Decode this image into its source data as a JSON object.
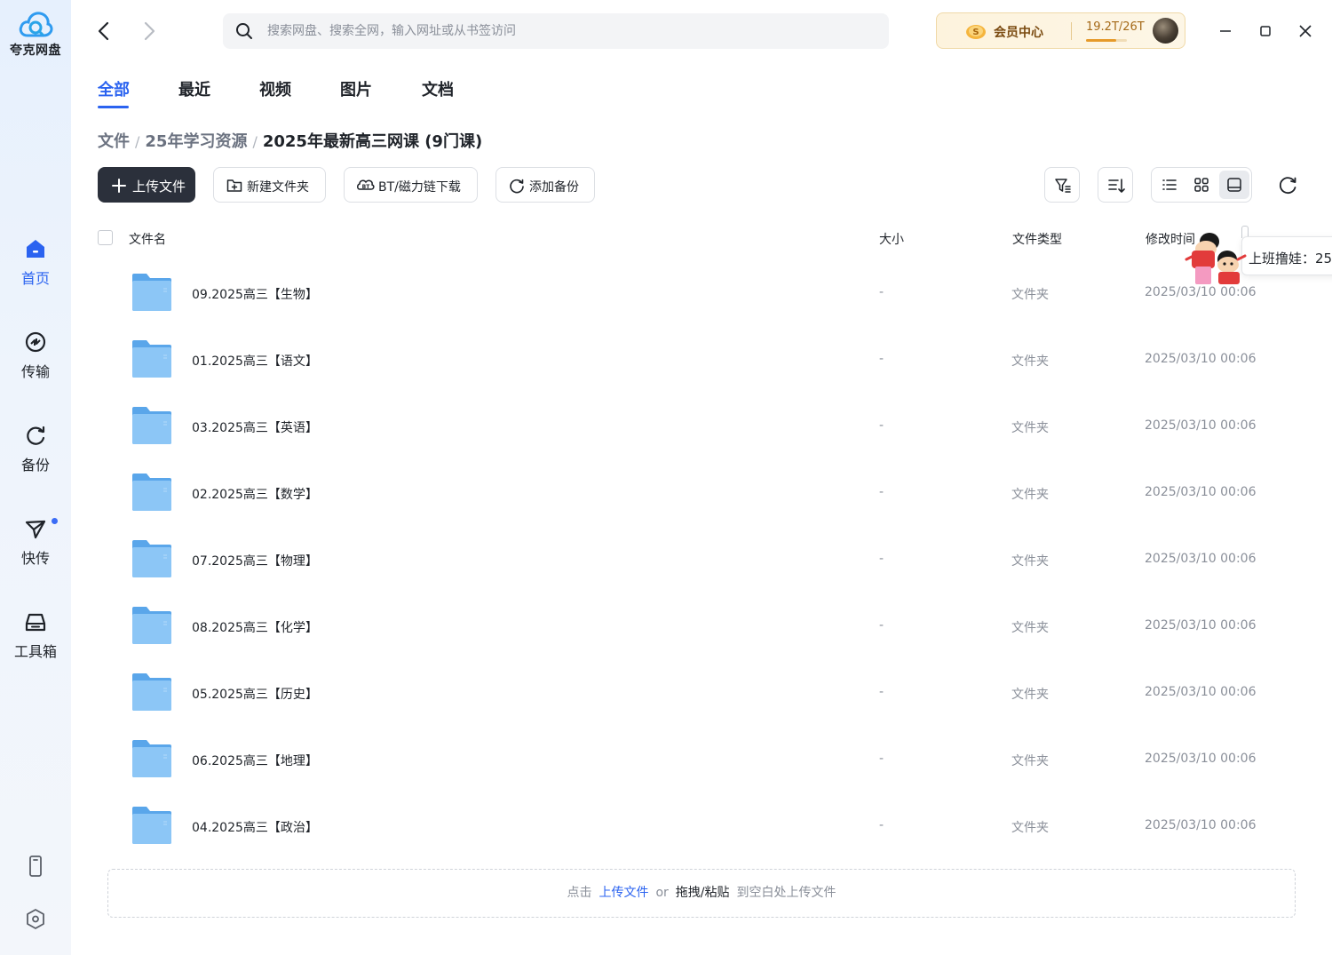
{
  "app": {
    "name": "夸克网盘"
  },
  "colors": {
    "accent": "#2b63f0",
    "primary_button": "#2b303b",
    "folder": "#6db0ee"
  },
  "sidebar": {
    "items": [
      {
        "label": "首页",
        "icon": "home-icon",
        "active": true
      },
      {
        "label": "传输",
        "icon": "transfer-icon"
      },
      {
        "label": "备份",
        "icon": "backup-icon"
      },
      {
        "label": "快传",
        "icon": "send-icon",
        "badge_dot": true
      },
      {
        "label": "工具箱",
        "icon": "toolbox-icon"
      }
    ],
    "bottom": [
      "phone-icon",
      "settings-hex-icon"
    ]
  },
  "search": {
    "placeholder": "搜索网盘、搜索全网，输入网址或从书签访问"
  },
  "member": {
    "label": "会员中心",
    "storage": "19.2T/26T",
    "storage_used_fraction": 0.738
  },
  "tabs": [
    {
      "label": "全部",
      "active": true
    },
    {
      "label": "最近"
    },
    {
      "label": "视频"
    },
    {
      "label": "图片"
    },
    {
      "label": "文档"
    }
  ],
  "breadcrumb": [
    "文件",
    "25年学习资源",
    "2025年最新高三网课 (9门课)"
  ],
  "toolbar": {
    "upload": "上传文件",
    "new_folder": "新建文件夹",
    "bt_download": "BT/磁力链下载",
    "add_backup": "添加备份"
  },
  "table": {
    "headers": {
      "name": "文件名",
      "size": "大小",
      "type": "文件类型",
      "modified": "修改时间"
    },
    "rows": [
      {
        "name": "09.2025高三【生物】",
        "size": "-",
        "type": "文件夹",
        "modified": "2025/03/10 00:06"
      },
      {
        "name": "01.2025高三【语文】",
        "size": "-",
        "type": "文件夹",
        "modified": "2025/03/10 00:06"
      },
      {
        "name": "03.2025高三【英语】",
        "size": "-",
        "type": "文件夹",
        "modified": "2025/03/10 00:06"
      },
      {
        "name": "02.2025高三【数学】",
        "size": "-",
        "type": "文件夹",
        "modified": "2025/03/10 00:06"
      },
      {
        "name": "07.2025高三【物理】",
        "size": "-",
        "type": "文件夹",
        "modified": "2025/03/10 00:06"
      },
      {
        "name": "08.2025高三【化学】",
        "size": "-",
        "type": "文件夹",
        "modified": "2025/03/10 00:06"
      },
      {
        "name": "05.2025高三【历史】",
        "size": "-",
        "type": "文件夹",
        "modified": "2025/03/10 00:06"
      },
      {
        "name": "06.2025高三【地理】",
        "size": "-",
        "type": "文件夹",
        "modified": "2025/03/10 00:06"
      },
      {
        "name": "04.2025高三【政治】",
        "size": "-",
        "type": "文件夹",
        "modified": "2025/03/10 00:06"
      }
    ]
  },
  "dropzone": {
    "prefix": "点击",
    "link": "上传文件",
    "or": "or",
    "paste": "拖拽/粘贴",
    "suffix": "到空白处上传文件"
  },
  "widget": {
    "text": "上班撸娃：25"
  }
}
